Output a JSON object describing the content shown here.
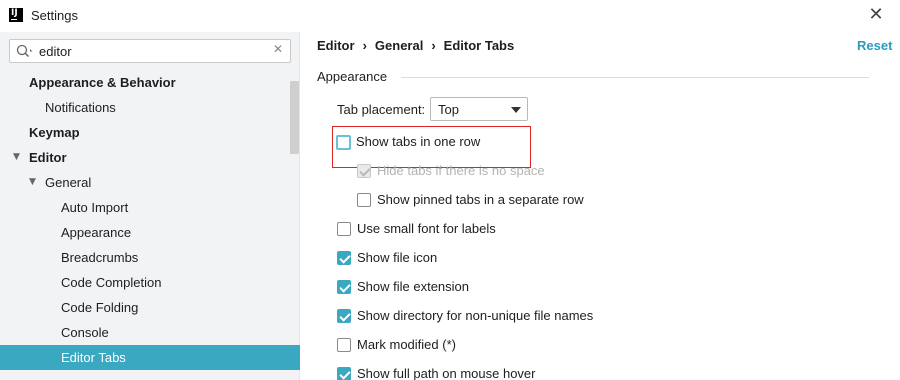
{
  "window": {
    "title": "Settings",
    "logo_letters": "IJ",
    "close_glyph": "✕"
  },
  "search": {
    "value": "editor",
    "clear_glyph": "✕"
  },
  "tree": {
    "items": [
      {
        "label": "Appearance & Behavior",
        "bold": true
      },
      {
        "label": "Notifications"
      },
      {
        "label": "Keymap",
        "bold": true
      },
      {
        "label": "Editor",
        "bold": true
      },
      {
        "label": "General"
      },
      {
        "label": "Auto Import"
      },
      {
        "label": "Appearance"
      },
      {
        "label": "Breadcrumbs"
      },
      {
        "label": "Code Completion"
      },
      {
        "label": "Code Folding"
      },
      {
        "label": "Console"
      },
      {
        "label": "Editor Tabs",
        "selected": true
      }
    ]
  },
  "breadcrumb": [
    "Editor",
    "General",
    "Editor Tabs"
  ],
  "breadcrumb_sep": "›",
  "reset_label": "Reset",
  "section": {
    "title": "Appearance"
  },
  "tab_placement": {
    "label": "Tab placement:",
    "value": "Top"
  },
  "options": [
    {
      "label": "Show tabs in one row",
      "checked": false,
      "focused": true
    },
    {
      "label": "Hide tabs if there is no space",
      "checked": true,
      "disabled": true
    },
    {
      "label": "Show pinned tabs in a separate row",
      "checked": false
    },
    {
      "label": "Use small font for labels",
      "checked": false
    },
    {
      "label": "Show file icon",
      "checked": true
    },
    {
      "label": "Show file extension",
      "checked": true
    },
    {
      "label": "Show directory for non-unique file names",
      "checked": true
    },
    {
      "label": "Mark modified (*)",
      "checked": false
    },
    {
      "label": "Show full path on mouse hover",
      "checked": true
    }
  ],
  "colors": {
    "accent": "#3aa8c1",
    "highlight_box": "#e02424",
    "link": "#2a9cc0"
  }
}
